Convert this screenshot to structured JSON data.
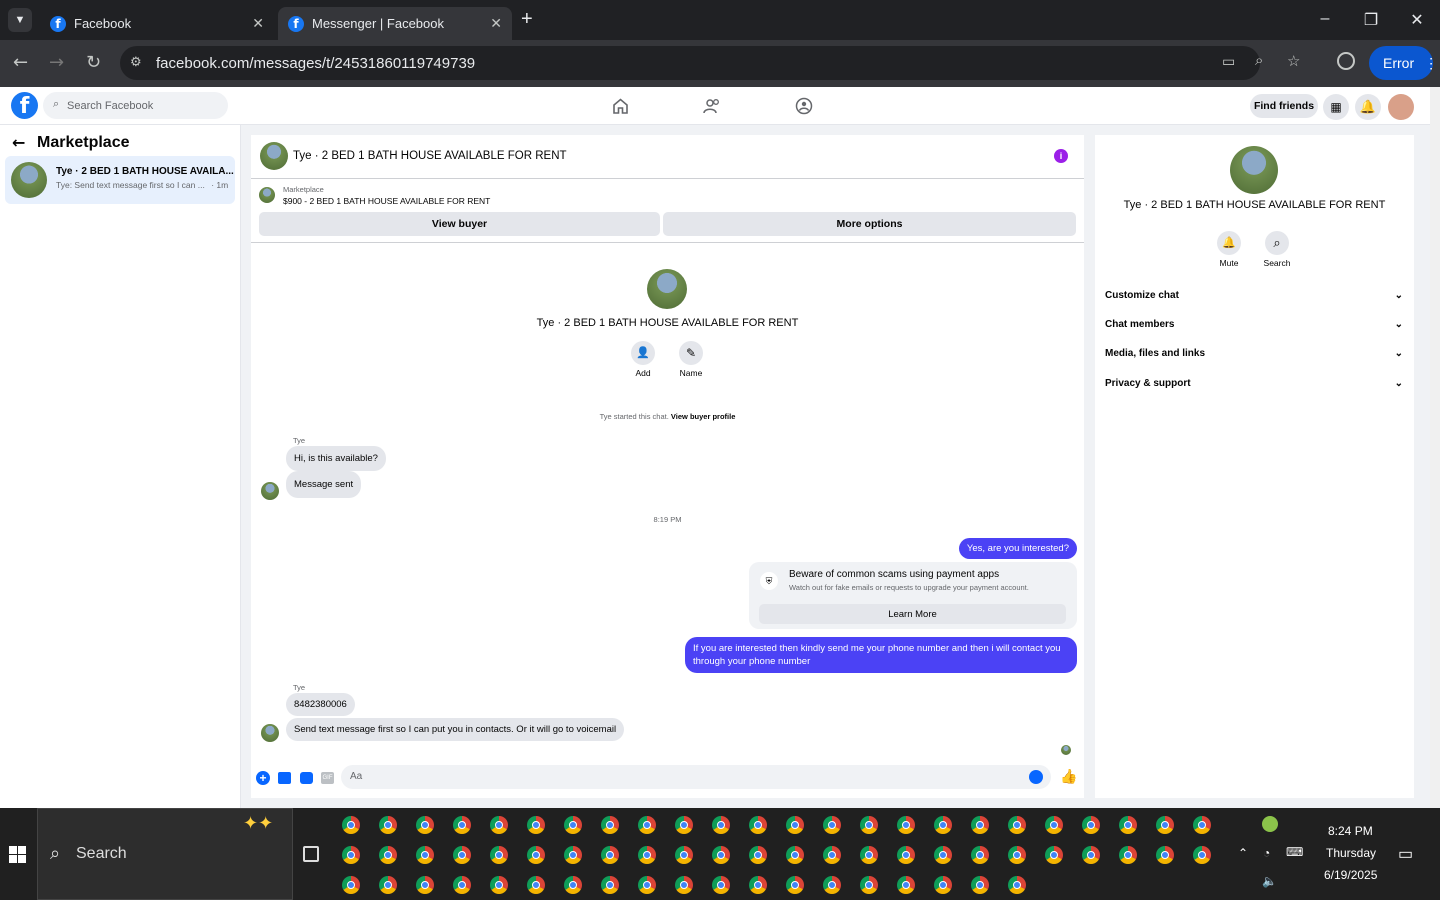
{
  "browser": {
    "tabs": [
      {
        "title": "Facebook",
        "active": false
      },
      {
        "title": "Messenger | Facebook",
        "active": true
      }
    ],
    "url": "facebook.com/messages/t/24531860119749739",
    "profile_button": "Error"
  },
  "fb_header": {
    "search_placeholder": "Search Facebook",
    "find_friends": "Find friends"
  },
  "left_panel": {
    "title": "Marketplace",
    "conversations": [
      {
        "name": "Tye · 2 BED 1 BATH HOUSE AVAILA...",
        "preview": "Tye: Send text message first so I can ...",
        "time": "· 1m"
      }
    ]
  },
  "chat": {
    "header_title": "Tye · 2 BED 1 BATH HOUSE AVAILABLE FOR RENT",
    "listing": {
      "label": "Marketplace",
      "text": "$900 - 2 BED 1 BATH HOUSE AVAILABLE FOR RENT"
    },
    "view_buyer": "View buyer",
    "more_options": "More options",
    "intro_title": "Tye · 2 BED 1 BATH HOUSE AVAILABLE FOR RENT",
    "add_label": "Add",
    "name_label": "Name",
    "started_text": "Tye started this chat.",
    "view_buyer_profile": "View buyer profile",
    "sender_1": "Tye",
    "msg_in_1": "Hi, is this available?",
    "msg_in_2": "Message sent",
    "timestamp": "8:19 PM",
    "msg_out_1": "Yes, are you interested?",
    "scam_title": "Beware of common scams using payment apps",
    "scam_sub": "Watch out for fake emails or requests to upgrade your payment account.",
    "learn_more": "Learn More",
    "msg_out_2": "If you are interested then kindly send me your phone number and then i will contact you through your phone number",
    "sender_2": "Tye",
    "msg_in_3": "8482380006",
    "msg_in_4": "Send text message first so I can put you in contacts. Or it will go to voicemail",
    "composer_placeholder": "Aa"
  },
  "right_panel": {
    "title": "Tye · 2 BED 1 BATH HOUSE AVAILABLE FOR RENT",
    "mute": "Mute",
    "search": "Search",
    "sections": [
      "Customize chat",
      "Chat members",
      "Media, files and links",
      "Privacy & support"
    ]
  },
  "taskbar": {
    "search": "Search",
    "time": "8:24 PM",
    "day": "Thursday",
    "date": "6/19/2025"
  }
}
